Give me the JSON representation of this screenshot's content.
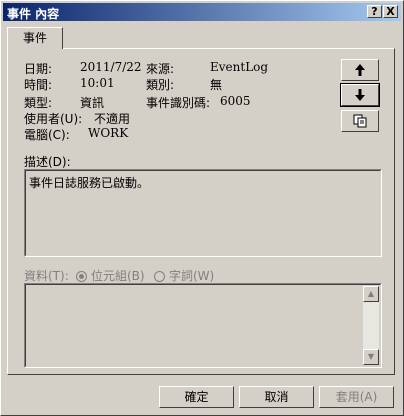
{
  "window": {
    "title": "事件 內容",
    "help_label": "?",
    "close_label": "X"
  },
  "tab": {
    "label": "事件"
  },
  "fields": {
    "date_label": "日期:",
    "date_value": "2011/7/22",
    "time_label": "時間:",
    "time_value": "10:01",
    "type_label": "類型:",
    "type_value": "資訊",
    "user_label": "使用者(U):",
    "user_value": "不適用",
    "computer_label": "電腦(C):",
    "computer_value": "WORK",
    "source_label": "來源:",
    "source_value": "EventLog",
    "category_label": "類別:",
    "category_value": "無",
    "event_id_label": "事件識別碼:",
    "event_id_value": "6005"
  },
  "nav": {
    "up_icon": "arrow-up-icon",
    "down_icon": "arrow-down-icon",
    "copy_icon": "copy-icon"
  },
  "description": {
    "label": "描述(D):",
    "text": "事件日誌服務已啟動。"
  },
  "data_section": {
    "label": "資料(T):",
    "bytes_label": "位元組(B)",
    "words_label": "字詞(W)"
  },
  "footer": {
    "ok_label": "確定",
    "cancel_label": "取消",
    "apply_label": "套用(A)"
  }
}
